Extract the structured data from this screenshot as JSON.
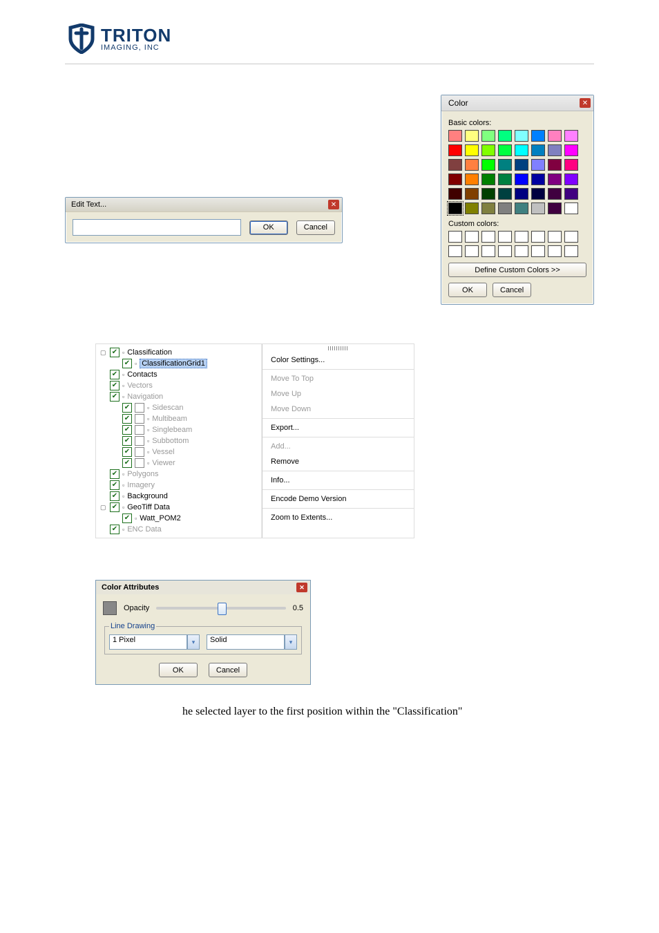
{
  "logo": {
    "brand": "TRITON",
    "sub": "IMAGING, INC"
  },
  "edit_dialog": {
    "title": "Edit Text...",
    "value": "",
    "ok": "OK",
    "cancel": "Cancel"
  },
  "color_dialog": {
    "title": "Color",
    "basic_label": "Basic colors:",
    "custom_label": "Custom colors:",
    "define": "Define Custom Colors >>",
    "ok": "OK",
    "cancel": "Cancel",
    "basic_rows": [
      [
        "#ff8080",
        "#ffff80",
        "#80ff80",
        "#00ff80",
        "#80ffff",
        "#0080ff",
        "#ff80c0",
        "#ff80ff"
      ],
      [
        "#ff0000",
        "#ffff00",
        "#80ff00",
        "#00ff40",
        "#00ffff",
        "#0080c0",
        "#8080c0",
        "#ff00ff"
      ],
      [
        "#804040",
        "#ff8040",
        "#00ff00",
        "#008080",
        "#004080",
        "#8080ff",
        "#800040",
        "#ff0080"
      ],
      [
        "#800000",
        "#ff8000",
        "#008000",
        "#008040",
        "#0000ff",
        "#0000a0",
        "#800080",
        "#8000ff"
      ],
      [
        "#400000",
        "#804000",
        "#004000",
        "#004040",
        "#000080",
        "#000040",
        "#400040",
        "#400080"
      ],
      [
        "#000000",
        "#808000",
        "#808040",
        "#808080",
        "#408080",
        "#c0c0c0",
        "#400040",
        "#ffffff"
      ]
    ]
  },
  "tree": {
    "items": [
      {
        "lvl": 0,
        "exp": "▢",
        "chk": true,
        "label": "Classification",
        "dim": false
      },
      {
        "lvl": 1,
        "exp": "",
        "chk": true,
        "label": "ClassificationGrid1",
        "sel": true,
        "dim": false
      },
      {
        "lvl": 0,
        "exp": "",
        "chk": true,
        "label": "Contacts",
        "dim": false
      },
      {
        "lvl": 0,
        "exp": "",
        "chk": true,
        "label": "Vectors",
        "dim": true
      },
      {
        "lvl": 0,
        "exp": "",
        "chk": true,
        "label": "Navigation",
        "dim": true
      },
      {
        "lvl": 1,
        "exp": "",
        "chk": true,
        "nochk": true,
        "label": "Sidescan",
        "dim": true
      },
      {
        "lvl": 1,
        "exp": "",
        "chk": true,
        "nochk": true,
        "label": "Multibeam",
        "dim": true
      },
      {
        "lvl": 1,
        "exp": "",
        "chk": true,
        "nochk": true,
        "label": "Singlebeam",
        "dim": true
      },
      {
        "lvl": 1,
        "exp": "",
        "chk": true,
        "nochk": true,
        "label": "Subbottom",
        "dim": true
      },
      {
        "lvl": 1,
        "exp": "",
        "chk": true,
        "nochk": true,
        "label": "Vessel",
        "dim": true
      },
      {
        "lvl": 1,
        "exp": "",
        "chk": true,
        "nochk": true,
        "label": "Viewer",
        "dim": true
      },
      {
        "lvl": 0,
        "exp": "",
        "chk": true,
        "label": "Polygons",
        "dim": true
      },
      {
        "lvl": 0,
        "exp": "",
        "chk": true,
        "label": "Imagery",
        "dim": true
      },
      {
        "lvl": 0,
        "exp": "",
        "chk": true,
        "label": "Background",
        "dim": false
      },
      {
        "lvl": 0,
        "exp": "▢",
        "chk": true,
        "label": "GeoTiff Data",
        "dim": false
      },
      {
        "lvl": 1,
        "exp": "",
        "chk": true,
        "label": "Watt_POM2",
        "dim": false
      },
      {
        "lvl": 0,
        "exp": "",
        "chk": true,
        "label": "ENC Data",
        "dim": true
      }
    ]
  },
  "context_menu": {
    "items": [
      {
        "label": "Color Settings...",
        "dim": false
      },
      {
        "sep": true
      },
      {
        "label": "Move To Top",
        "dim": true
      },
      {
        "label": "Move Up",
        "dim": true
      },
      {
        "label": "Move Down",
        "dim": true
      },
      {
        "sep": true
      },
      {
        "label": "Export...",
        "dim": false
      },
      {
        "sep": true
      },
      {
        "label": "Add...",
        "dim": true
      },
      {
        "label": "Remove",
        "dim": false
      },
      {
        "sep": true
      },
      {
        "label": "Info...",
        "dim": false
      },
      {
        "sep": true
      },
      {
        "label": "Encode Demo Version",
        "dim": false
      },
      {
        "sep": true
      },
      {
        "label": "Zoom to Extents...",
        "dim": false
      }
    ]
  },
  "color_attr": {
    "title": "Color Attributes",
    "opacity_label": "Opacity",
    "opacity_value": "0.5",
    "slider_pos_pct": 50,
    "group": "Line Drawing",
    "width_value": "1 Pixel",
    "style_value": "Solid",
    "ok": "OK",
    "cancel": "Cancel"
  },
  "caption": "he selected layer to the first position within the \"Classification\""
}
